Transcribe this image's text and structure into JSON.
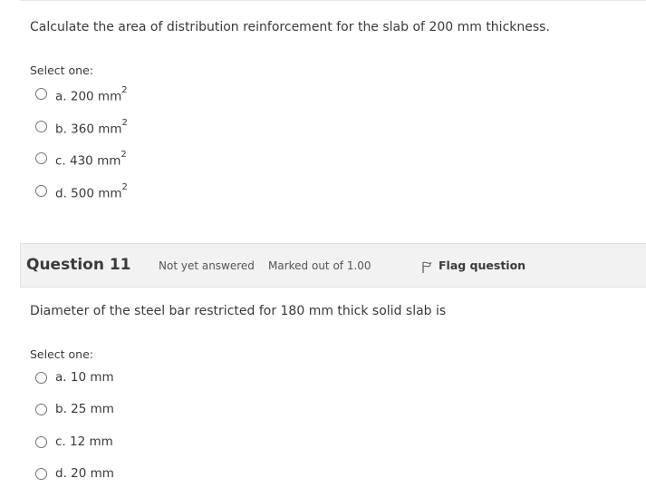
{
  "q10": {
    "text": "Calculate the area of distribution reinforcement for the slab of 200 mm thickness.",
    "select_one": "Select one:",
    "options": [
      {
        "label": "a. 200 mm",
        "sup": "2"
      },
      {
        "label": "b. 360 mm",
        "sup": "2"
      },
      {
        "label": "c. 430 mm",
        "sup": "2"
      },
      {
        "label": "d. 500 mm",
        "sup": "2"
      }
    ]
  },
  "q11": {
    "title": "Question 11",
    "state": "Not yet answered",
    "grade": "Marked out of 1.00",
    "flag_label": "Flag question",
    "flag_icon": "flag-icon",
    "text": "Diameter of the steel bar restricted for 180 mm thick solid slab is",
    "select_one": "Select one:",
    "options": [
      {
        "label": "a. 10 mm"
      },
      {
        "label": "b. 25 mm"
      },
      {
        "label": "c. 12 mm"
      },
      {
        "label": "d. 20 mm"
      }
    ]
  }
}
